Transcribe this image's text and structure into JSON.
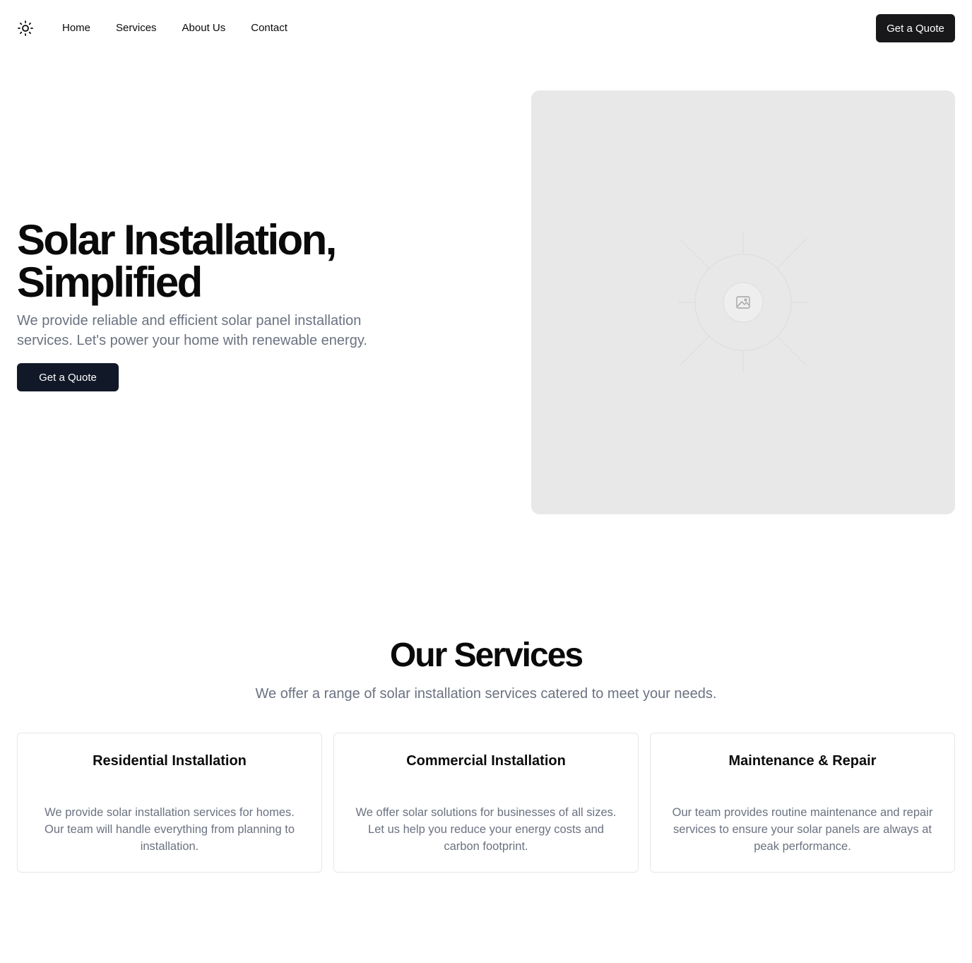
{
  "nav": {
    "logo_icon": "sun-icon",
    "links": [
      "Home",
      "Services",
      "About Us",
      "Contact"
    ],
    "cta_label": "Get a Quote"
  },
  "hero": {
    "title_line1": "Solar Installation,",
    "title_line2": "Simplified",
    "description": "We provide reliable and efficient solar panel installation services. Let's power your home with renewable energy.",
    "cta_label": "Get a Quote",
    "image_icon": "image-placeholder-icon"
  },
  "services": {
    "title": "Our Services",
    "subtitle": "We offer a range of solar installation services catered to meet your needs.",
    "cards": [
      {
        "title": "Residential Installation",
        "text": "We provide solar installation services for homes. Our team will handle everything from planning to installation."
      },
      {
        "title": "Commercial Installation",
        "text": "We offer solar solutions for businesses of all sizes. Let us help you reduce your energy costs and carbon footprint."
      },
      {
        "title": "Maintenance & Repair",
        "text": "Our team provides routine maintenance and repair services to ensure your solar panels are always at peak performance."
      }
    ]
  },
  "colors": {
    "primary_dark": "#18181b",
    "hero_button": "#111827",
    "muted_text": "#6b7280",
    "placeholder_bg": "#e8e8e8",
    "card_border": "#e5e7eb"
  }
}
